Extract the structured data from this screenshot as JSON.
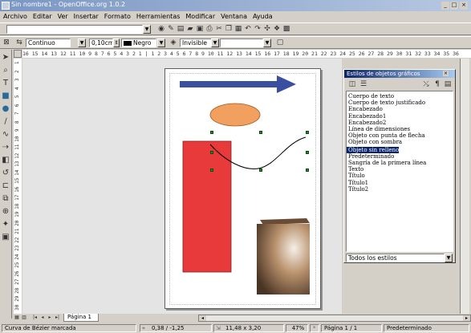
{
  "window": {
    "title": "Sin nombre1 - OpenOffice.org 1.0.2"
  },
  "menu": [
    "Archivo",
    "Editar",
    "Ver",
    "Insertar",
    "Formato",
    "Herramientas",
    "Modificar",
    "Ventana",
    "Ayuda"
  ],
  "line_toolbar": {
    "line_style": "Continuo",
    "line_width": "0,10cm",
    "line_color": "Negro",
    "area_style": "Invisible"
  },
  "ruler": {
    "h_ticks": "16 15 14 13 12 11 10  9  8  7  6  5  4  3  2  1  |  1  2  3  4  5  6  7  8  9 10 11 12 13 14 15 16 17 18 19 20 21 22 23 24 25 26 27 28 29 30 31 32 33 34 35 36",
    "v_ticks": [
      "1",
      "2",
      "3",
      "4",
      "5",
      "6",
      "7",
      "8",
      "9",
      "10",
      "11",
      "12",
      "13",
      "14",
      "15",
      "16",
      "17",
      "18",
      "19",
      "20",
      "21",
      "22",
      "23",
      "24",
      "25",
      "26",
      "27",
      "28",
      "29",
      "30"
    ]
  },
  "stylist": {
    "title": "Estilos de objetos gráficos",
    "items": [
      "Cuerpo de texto",
      "Cuerpo de texto justificado",
      "Encabezado",
      "Encabezado1",
      "Encabezado2",
      "Línea de dimensiones",
      "Objeto con punta de flecha",
      "Objeto con sombra",
      "Objeto sin relleno",
      "Predeterminado",
      "Sangría de la primera línea",
      "Texto",
      "Título",
      "Título1",
      "Título2"
    ],
    "selected_index": 8,
    "filter": "Todos los estilos"
  },
  "tabs": {
    "page": "Página 1"
  },
  "status": {
    "message": "Curva de Bézier marcada",
    "position": "0,38 / -1,25",
    "size": "11,48 x 3,20",
    "zoom": "47%",
    "page": "Página 1 / 1",
    "layout": "Predeterminado"
  },
  "colors": {
    "arrow": "#3a4fa0",
    "ellipse": "#f2a060",
    "rectangle": "#e83a3a",
    "selection_bg": "#0a246a"
  },
  "icons": {
    "select": "arrow-icon",
    "text": "text-icon",
    "rectangle": "rectangle-icon",
    "ellipse": "ellipse-icon",
    "line": "line-icon",
    "curve": "curve-icon",
    "connector": "connector-icon",
    "3d": "cube-icon"
  }
}
